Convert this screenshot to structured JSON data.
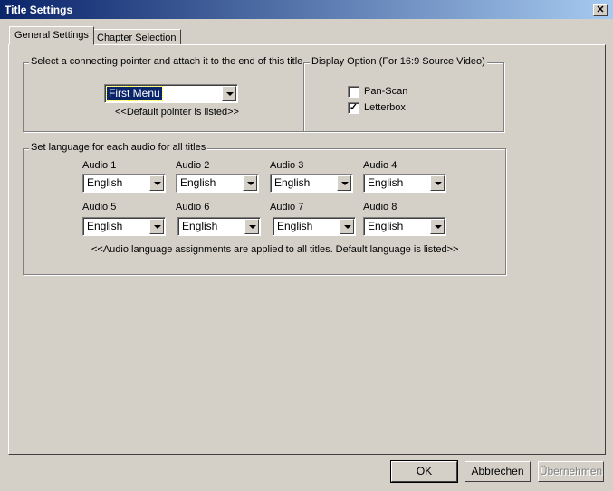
{
  "window": {
    "title": "Title Settings",
    "close_glyph": "✕"
  },
  "tabs": [
    {
      "label": "General Settings",
      "active": true
    },
    {
      "label": "Chapter Selection",
      "active": false
    }
  ],
  "pointer_group": {
    "legend": "Select a connecting pointer and attach it to the end of this title",
    "selected": "First Menu",
    "hint": "<<Default pointer is listed>>"
  },
  "display_group": {
    "legend": "Display Option (For 16:9 Source Video)",
    "options": [
      {
        "label": "Pan-Scan",
        "checked": false
      },
      {
        "label": "Letterbox",
        "checked": true
      }
    ],
    "check_glyph": "✓"
  },
  "audio_group": {
    "legend": "Set language for each audio for all titles",
    "audios": [
      {
        "label": "Audio 1",
        "value": "English"
      },
      {
        "label": "Audio 2",
        "value": "English"
      },
      {
        "label": "Audio 3",
        "value": "English"
      },
      {
        "label": "Audio 4",
        "value": "English"
      },
      {
        "label": "Audio 5",
        "value": "English"
      },
      {
        "label": "Audio 6",
        "value": "English"
      },
      {
        "label": "Audio 7",
        "value": "English"
      },
      {
        "label": "Audio 8",
        "value": "English"
      }
    ],
    "hint": "<<Audio language assignments are applied to all titles. Default language is listed>>"
  },
  "buttons": {
    "ok": "OK",
    "cancel": "Abbrechen",
    "apply": "Übernehmen"
  }
}
